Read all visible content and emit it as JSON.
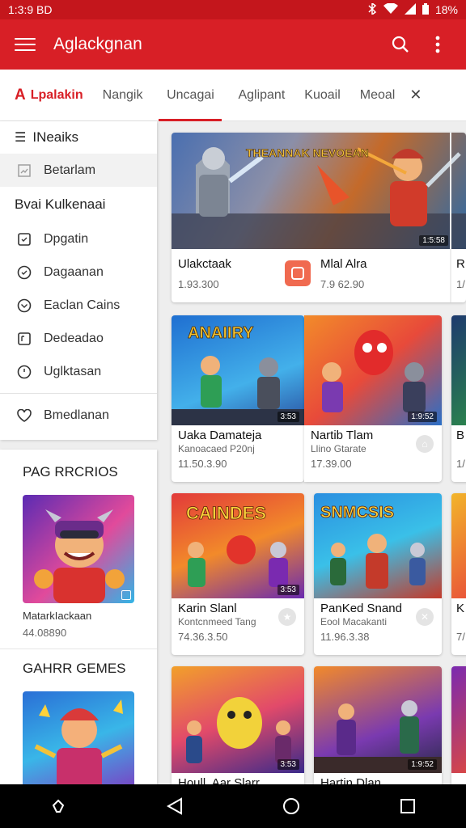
{
  "status": {
    "time": "1:3:9 BD",
    "battery": "18%"
  },
  "appbar": {
    "title": "Aglackgnan",
    "menu_icon": "hamburger-menu-icon",
    "search_icon": "search-icon",
    "more_icon": "overflow-menu-icon"
  },
  "tabs": [
    {
      "label": "Lpalakin",
      "brand": true
    },
    {
      "label": "Nangik"
    },
    {
      "label": "Uncagai",
      "selected": true
    },
    {
      "label": "Aglipant"
    },
    {
      "label": "Kuoail"
    },
    {
      "label": "Meoal"
    }
  ],
  "sidebar": {
    "header": "INeaiks",
    "first_item": "Betarlam",
    "section": "Bvai Kulkenaai",
    "items": [
      "Dpgatin",
      "Dagaanan",
      "Eaclan Cains",
      "Dedeadao",
      "Uglktasan"
    ],
    "footer_item": "Bmedlanan"
  },
  "promo": {
    "section1_title": "PAG RRCRIOS",
    "item1_caption": "MatarkIackaan",
    "item1_sub": "44.08890",
    "section2_title": "GAHRR GEMES"
  },
  "cards": [
    {
      "title": "Ulakctaak",
      "meta": "",
      "value": "1.93.300",
      "badge": "1:5:58",
      "title2": "Mlal Alra",
      "value2": "7.9 62.90"
    },
    {
      "title": "Uaka Damateja",
      "meta": "Kanoacaed P20nj",
      "value": "11.50.3.90",
      "badge": "3:53"
    },
    {
      "title": "Nartib Tlam",
      "meta": "Llino Gtarate",
      "value": "17.39.00",
      "badge": "1:9:52"
    },
    {
      "title": "Karin Slanl",
      "meta": "Kontcnmeed Tang",
      "value": "74.36.3.50",
      "badge": "3:53"
    },
    {
      "title": "PanKed Snand",
      "meta": "Eool Macakanti",
      "value": "11.96.3.38",
      "badge": ""
    },
    {
      "title": "Houll. Aar Slarr",
      "meta": "",
      "value": "",
      "badge": "3:53"
    },
    {
      "title": "Hartin Dlan",
      "meta": "",
      "value": "",
      "badge": "1:9:52"
    }
  ],
  "banners": {
    "hero": "THEANNAK NEVOEAN",
    "card1": "ANAIIRY",
    "card3": "CAINDES",
    "card4": "SNMCSIS"
  },
  "edge_labels": [
    "R",
    "1/",
    "B",
    "1/",
    "K",
    "7/"
  ],
  "colors": {
    "primary": "#d81f26",
    "status_bar": "#c4161c",
    "background": "#eeeeee"
  }
}
